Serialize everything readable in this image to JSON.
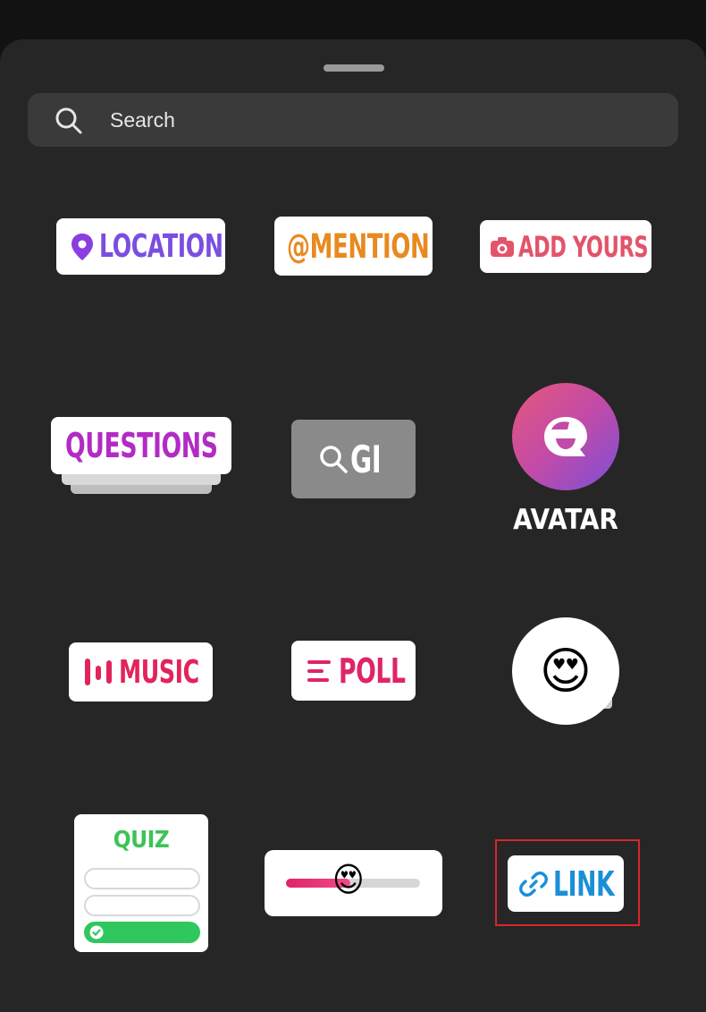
{
  "search": {
    "placeholder": "Search"
  },
  "stickers": {
    "location": "LOCATION",
    "mention": "@MENTION",
    "add_yours": "ADD YOURS",
    "questions": "QUESTIONS",
    "gif": "GI",
    "avatar": "AVATAR",
    "music": "MUSIC",
    "poll": "POLL",
    "emoji": "😍",
    "quiz": "QUIZ",
    "slider_emoji": "😍",
    "link": "LINK"
  },
  "colors": {
    "sheet_bg": "#262626",
    "location": "#7a4ee0",
    "mention": "#e88a1f",
    "add_yours": "#e2546a",
    "questions": "#b32ac5",
    "music": "#e2245a",
    "poll": "#e0246a",
    "quiz": "#3cc35a",
    "link": "#1a8fd8",
    "highlight": "#d8262a"
  },
  "icons": [
    "search-icon",
    "location-pin-icon",
    "camera-icon",
    "gif-search-icon",
    "avatar-face-icon",
    "music-bars-icon",
    "poll-lines-icon",
    "check-icon",
    "link-chain-icon"
  ]
}
